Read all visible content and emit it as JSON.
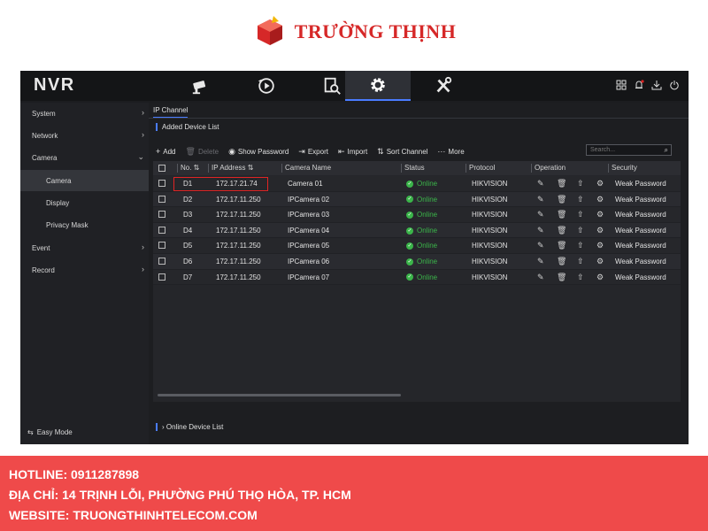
{
  "brand": {
    "name": "TRƯỜNG THỊNH",
    "logo_icon": "cube-logo-icon",
    "color": "#d62828"
  },
  "nvr": {
    "title": "NVR",
    "nav_tabs": [
      {
        "icon": "camera-icon",
        "active": false
      },
      {
        "icon": "playback-icon",
        "active": false
      },
      {
        "icon": "file-search-icon",
        "active": false
      },
      {
        "icon": "gear-icon",
        "active": true
      },
      {
        "icon": "tools-icon",
        "active": false
      }
    ],
    "system_icons": [
      "grid-icon",
      "bell-icon",
      "download-icon",
      "power-icon"
    ],
    "accent": "#4a7cff",
    "sidebar": {
      "items": [
        {
          "label": "System",
          "chevron": "›"
        },
        {
          "label": "Network",
          "chevron": "›"
        },
        {
          "label": "Camera",
          "chevron": "⌄"
        },
        {
          "label": "Camera",
          "sub": true,
          "selected": true
        },
        {
          "label": "Display",
          "sub": true
        },
        {
          "label": "Privacy Mask",
          "sub": true
        },
        {
          "label": "Event",
          "chevron": "›"
        },
        {
          "label": "Record",
          "chevron": "›"
        }
      ],
      "easy_mode": "Easy Mode"
    },
    "tab": "IP Channel",
    "section_title": "Added Device List",
    "toolbar": {
      "add": "Add",
      "delete": "Delete",
      "show_password": "Show Password",
      "export": "Export",
      "import": "Import",
      "sort_channel": "Sort Channel",
      "more": "More"
    },
    "search_placeholder": "Search...",
    "table": {
      "headers": [
        "No.",
        "IP Address",
        "Camera Name",
        "Status",
        "Protocol",
        "Operation",
        "Security"
      ],
      "rows": [
        {
          "no": "D1",
          "ip": "172.17.21.74",
          "name": "Camera 01",
          "status": "Online",
          "protocol": "HIKVISION",
          "security": "Weak Password"
        },
        {
          "no": "D2",
          "ip": "172.17.11.250",
          "name": "IPCamera 02",
          "status": "Online",
          "protocol": "HIKVISION",
          "security": "Weak Password"
        },
        {
          "no": "D3",
          "ip": "172.17.11.250",
          "name": "IPCamera 03",
          "status": "Online",
          "protocol": "HIKVISION",
          "security": "Weak Password"
        },
        {
          "no": "D4",
          "ip": "172.17.11.250",
          "name": "IPCamera 04",
          "status": "Online",
          "protocol": "HIKVISION",
          "security": "Weak Password"
        },
        {
          "no": "D5",
          "ip": "172.17.11.250",
          "name": "IPCamera 05",
          "status": "Online",
          "protocol": "HIKVISION",
          "security": "Weak Password"
        },
        {
          "no": "D6",
          "ip": "172.17.11.250",
          "name": "IPCamera 06",
          "status": "Online",
          "protocol": "HIKVISION",
          "security": "Weak Password"
        },
        {
          "no": "D7",
          "ip": "172.17.11.250",
          "name": "IPCamera 07",
          "status": "Online",
          "protocol": "HIKVISION",
          "security": "Weak Password"
        }
      ],
      "status_color": "#3bb54a",
      "highlight_color": "#e02424"
    },
    "online_device_list": "Online Device List"
  },
  "footer": {
    "hotline": "HOTLINE: 0911287898",
    "address": "ĐỊA CHỈ: 14 TRỊNH LỖI, PHƯỜNG PHÚ THỌ HÒA, TP. HCM",
    "website": "WEBSITE: TRUONGTHINHTELECOM.COM",
    "background": "#ef4a4a"
  }
}
